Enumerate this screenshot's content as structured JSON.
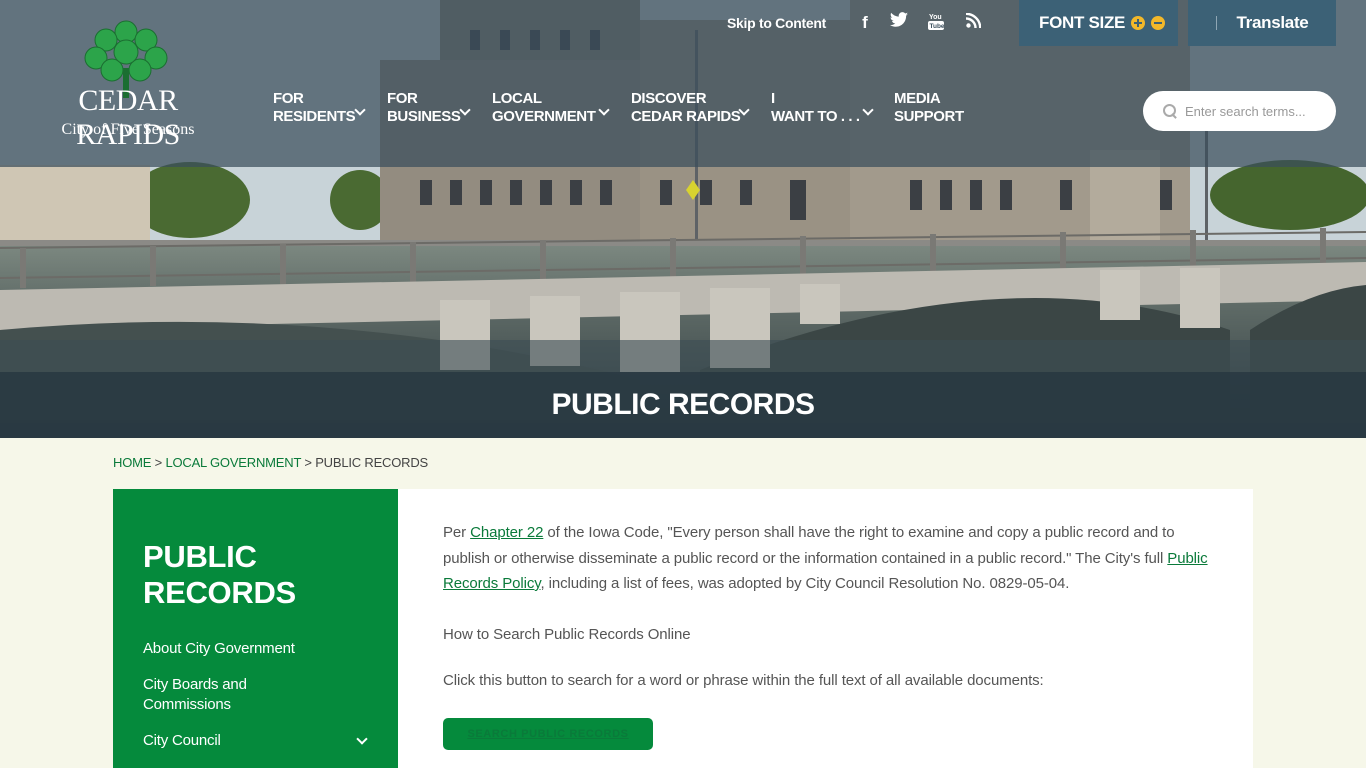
{
  "logo": {
    "wordmark": "CEDAR RAPIDS",
    "tagline": "City of Five Seasons"
  },
  "utility": {
    "skip_label": "Skip to Content",
    "social": [
      "facebook-icon",
      "twitter-icon",
      "youtube-icon",
      "rss-icon"
    ],
    "font_size_label": "FONT SIZE",
    "translate_label": "Translate"
  },
  "nav": {
    "items": [
      {
        "line1": "FOR",
        "line2": "RESIDENTS"
      },
      {
        "line1": "FOR",
        "line2": "BUSINESS"
      },
      {
        "line1": "LOCAL",
        "line2": "GOVERNMENT"
      },
      {
        "line1": "DISCOVER",
        "line2": "CEDAR RAPIDS"
      },
      {
        "line1": "I",
        "line2": "WANT TO . . ."
      },
      {
        "line1": "MEDIA",
        "line2": "SUPPORT"
      }
    ]
  },
  "search": {
    "placeholder": "Enter search terms..."
  },
  "page": {
    "title": "PUBLIC RECORDS"
  },
  "breadcrumb": {
    "home": "HOME",
    "sep": ">",
    "section": "LOCAL GOVERNMENT",
    "current": "PUBLIC RECORDS"
  },
  "sidebar": {
    "heading_line1": "PUBLIC",
    "heading_line2": "RECORDS",
    "items": [
      {
        "label": "About City Government"
      },
      {
        "label_line1": "City Boards and",
        "label_line2": "Commissions"
      },
      {
        "label": "City Council"
      }
    ]
  },
  "content": {
    "p1_prefix": "Per ",
    "p1_link1": "Chapter 22",
    "p1_middle": " of the Iowa Code, \"Every person shall have the right to examine and copy a public record and to publish or otherwise disseminate a public record or the information contained in a public record.\" The City's full ",
    "p1_link2": "Public Records Policy",
    "p1_suffix": ", including a list of fees, was adopted by City Council Resolution No. 0829-05-04.",
    "p2": "How to Search Public Records Online",
    "p3": "Click this button to search for a word or phrase within the full text of all available documents:",
    "button_label": "SEARCH PUBLIC RECORDS"
  },
  "colors": {
    "brand_green": "#058a3c",
    "link_green": "#0a7a3a",
    "utility_blue": "#3c6176",
    "accent_yellow": "#f2b82a",
    "page_bg": "#f6f7e9"
  }
}
